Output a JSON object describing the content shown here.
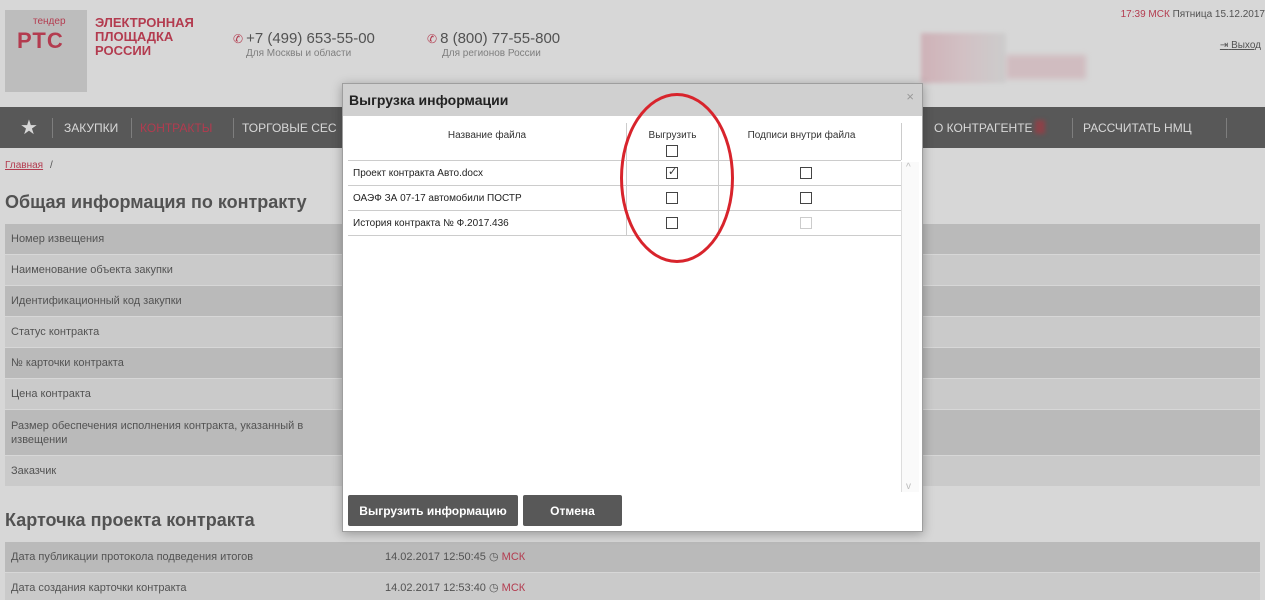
{
  "header": {
    "logo_small": "тендер",
    "logo_big": "РТС",
    "brand_lines": [
      "ЭЛЕКТРОННАЯ",
      "ПЛОЩАДКА",
      "РОССИИ"
    ],
    "phone1": "+7 (499) 653-55-00",
    "phone1_sub": "Для Москвы и области",
    "phone2": "8 (800) 77-55-800",
    "phone2_sub": "Для регионов России",
    "time": "17:39 МСК",
    "date": "Пятница 15.12.2017",
    "logout": "Выход"
  },
  "nav": {
    "items": [
      "ЗАКУПКИ",
      "КОНТРАКТЫ",
      "ТОРГОВЫЕ СЕС",
      "О КОНТРАГЕНТЕ",
      "РАССЧИТАТЬ НМЦ"
    ]
  },
  "page": {
    "breadcrumb": "Главная",
    "breadcrumb_sep": "/",
    "section1_title": "Общая информация по контракту",
    "rows1": [
      "Номер извещения",
      "Наименование объекта закупки",
      "Идентификационный код закупки",
      "Статус контракта",
      "№ карточки контракта",
      "Цена контракта",
      "Размер обеспечения исполнения контракта, указанный в извещении",
      "Заказчик"
    ],
    "section2_title": "Карточка проекта контракта",
    "rows2": [
      {
        "label": "Дата публикации протокола подведения итогов",
        "value": "14.02.2017 12:50:45",
        "tz": "МСК"
      },
      {
        "label": "Дата создания карточки контракта",
        "value": "14.02.2017 12:53:40",
        "tz": "МСК"
      }
    ]
  },
  "modal": {
    "title": "Выгрузка информации",
    "close": "×",
    "col_name": "Название файла",
    "col_export": "Выгрузить",
    "col_sign": "Подписи внутри файла",
    "files": [
      {
        "name": "Проект контракта Авто.docx",
        "export": true,
        "sign": false,
        "sign_disabled": false
      },
      {
        "name": "ОАЭФ ЗА 07-17 автомобили ПОСТР",
        "export": false,
        "sign": false,
        "sign_disabled": false
      },
      {
        "name": "История контракта № Ф.2017.436",
        "export": false,
        "sign": false,
        "sign_disabled": true
      }
    ],
    "export_all": false,
    "btn_export": "Выгрузить информацию",
    "btn_cancel": "Отмена"
  },
  "colors": {
    "brand_red": "#c8102e",
    "nav_bg": "#3c3c3c",
    "button_bg": "#585858",
    "annotation": "#d8242c"
  }
}
